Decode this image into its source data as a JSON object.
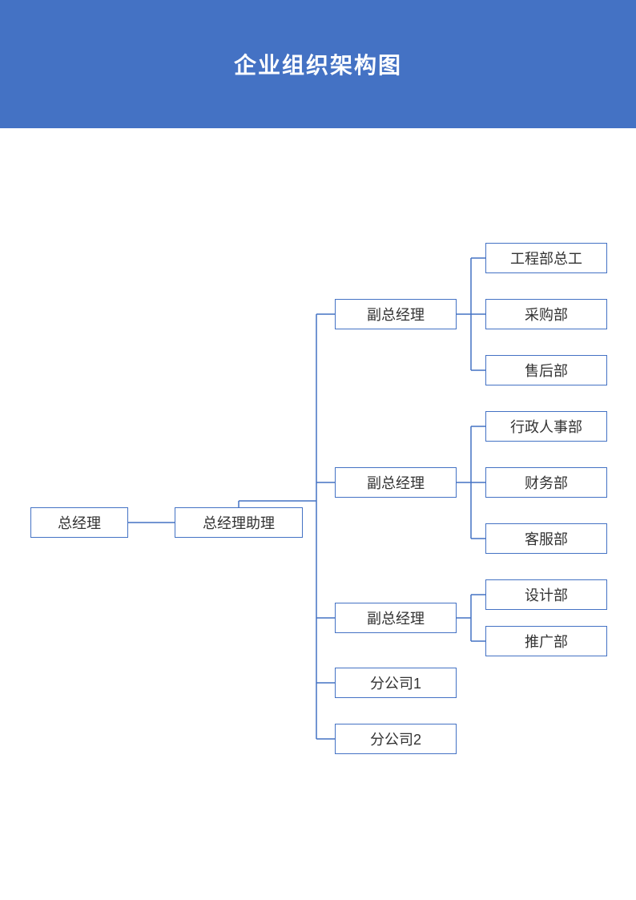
{
  "title": "企业组织架构图",
  "colors": {
    "primary": "#4472c4",
    "text": "#333333",
    "bg": "#ffffff"
  },
  "org": {
    "root": {
      "label": "总经理"
    },
    "assistant": {
      "label": "总经理助理"
    },
    "branches": [
      {
        "label": "副总经理",
        "children": [
          {
            "label": "工程部总工"
          },
          {
            "label": "采购部"
          },
          {
            "label": "售后部"
          }
        ]
      },
      {
        "label": "副总经理",
        "children": [
          {
            "label": "行政人事部"
          },
          {
            "label": "财务部"
          },
          {
            "label": "客服部"
          }
        ]
      },
      {
        "label": "副总经理",
        "children": [
          {
            "label": "设计部"
          },
          {
            "label": "推广部"
          }
        ]
      },
      {
        "label": "分公司1",
        "children": []
      },
      {
        "label": "分公司2",
        "children": []
      }
    ]
  }
}
